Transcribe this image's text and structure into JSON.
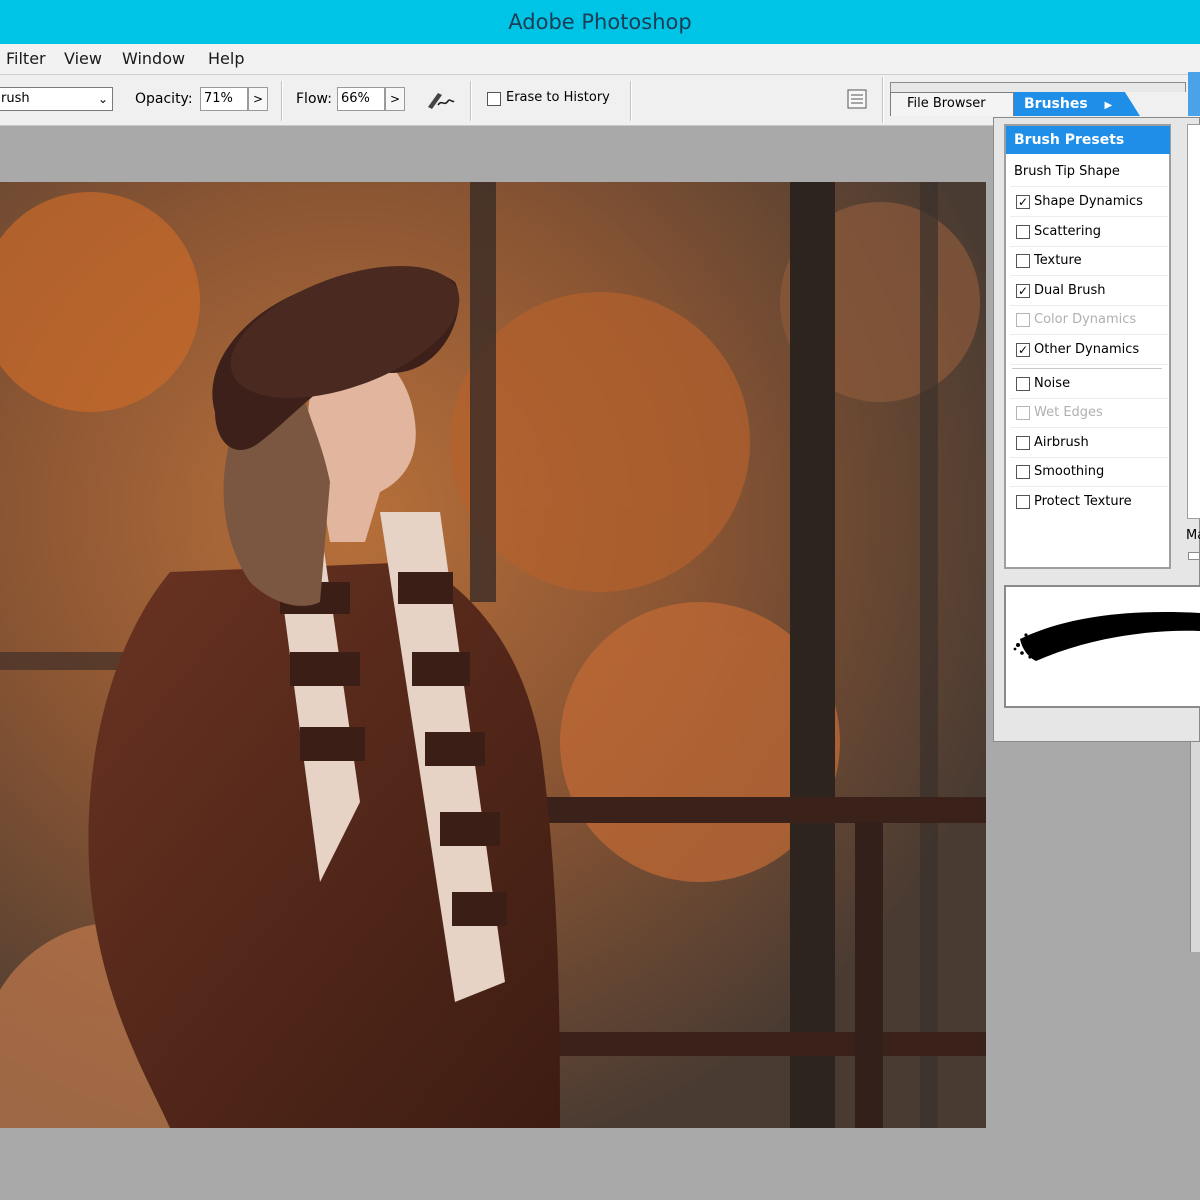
{
  "window": {
    "title": "Adobe Photoshop"
  },
  "menu": {
    "items": [
      "Filter",
      "View",
      "Window",
      "Help"
    ]
  },
  "options": {
    "tool_preset": "rush",
    "opacity_label": "Opacity:",
    "opacity_value": "71%",
    "flow_label": "Flow:",
    "flow_value": "66%",
    "erase_to_history_label": "Erase to History",
    "erase_to_history_checked": false
  },
  "panel_tabs": {
    "file_browser": "File Browser",
    "brushes": "Brushes"
  },
  "brushes_panel": {
    "header": "Brush Presets",
    "brush_tip_shape": "Brush Tip Shape",
    "options": [
      {
        "label": "Shape Dynamics",
        "checked": true,
        "enabled": true
      },
      {
        "label": "Scattering",
        "checked": false,
        "enabled": true
      },
      {
        "label": "Texture",
        "checked": false,
        "enabled": true
      },
      {
        "label": "Dual Brush",
        "checked": true,
        "enabled": true
      },
      {
        "label": "Color Dynamics",
        "checked": false,
        "enabled": false
      },
      {
        "label": "Other Dynamics",
        "checked": true,
        "enabled": true
      },
      {
        "label": "Noise",
        "checked": false,
        "enabled": true
      },
      {
        "label": "Wet Edges",
        "checked": false,
        "enabled": false
      },
      {
        "label": "Airbrush",
        "checked": false,
        "enabled": true
      },
      {
        "label": "Smoothing",
        "checked": false,
        "enabled": true
      },
      {
        "label": "Protect Texture",
        "checked": false,
        "enabled": true
      }
    ],
    "side_label": "Ma"
  },
  "colors": {
    "titlebar": "#00c4e6",
    "accent": "#1e8ee8",
    "canvas_bg": "#a9a9a9"
  }
}
